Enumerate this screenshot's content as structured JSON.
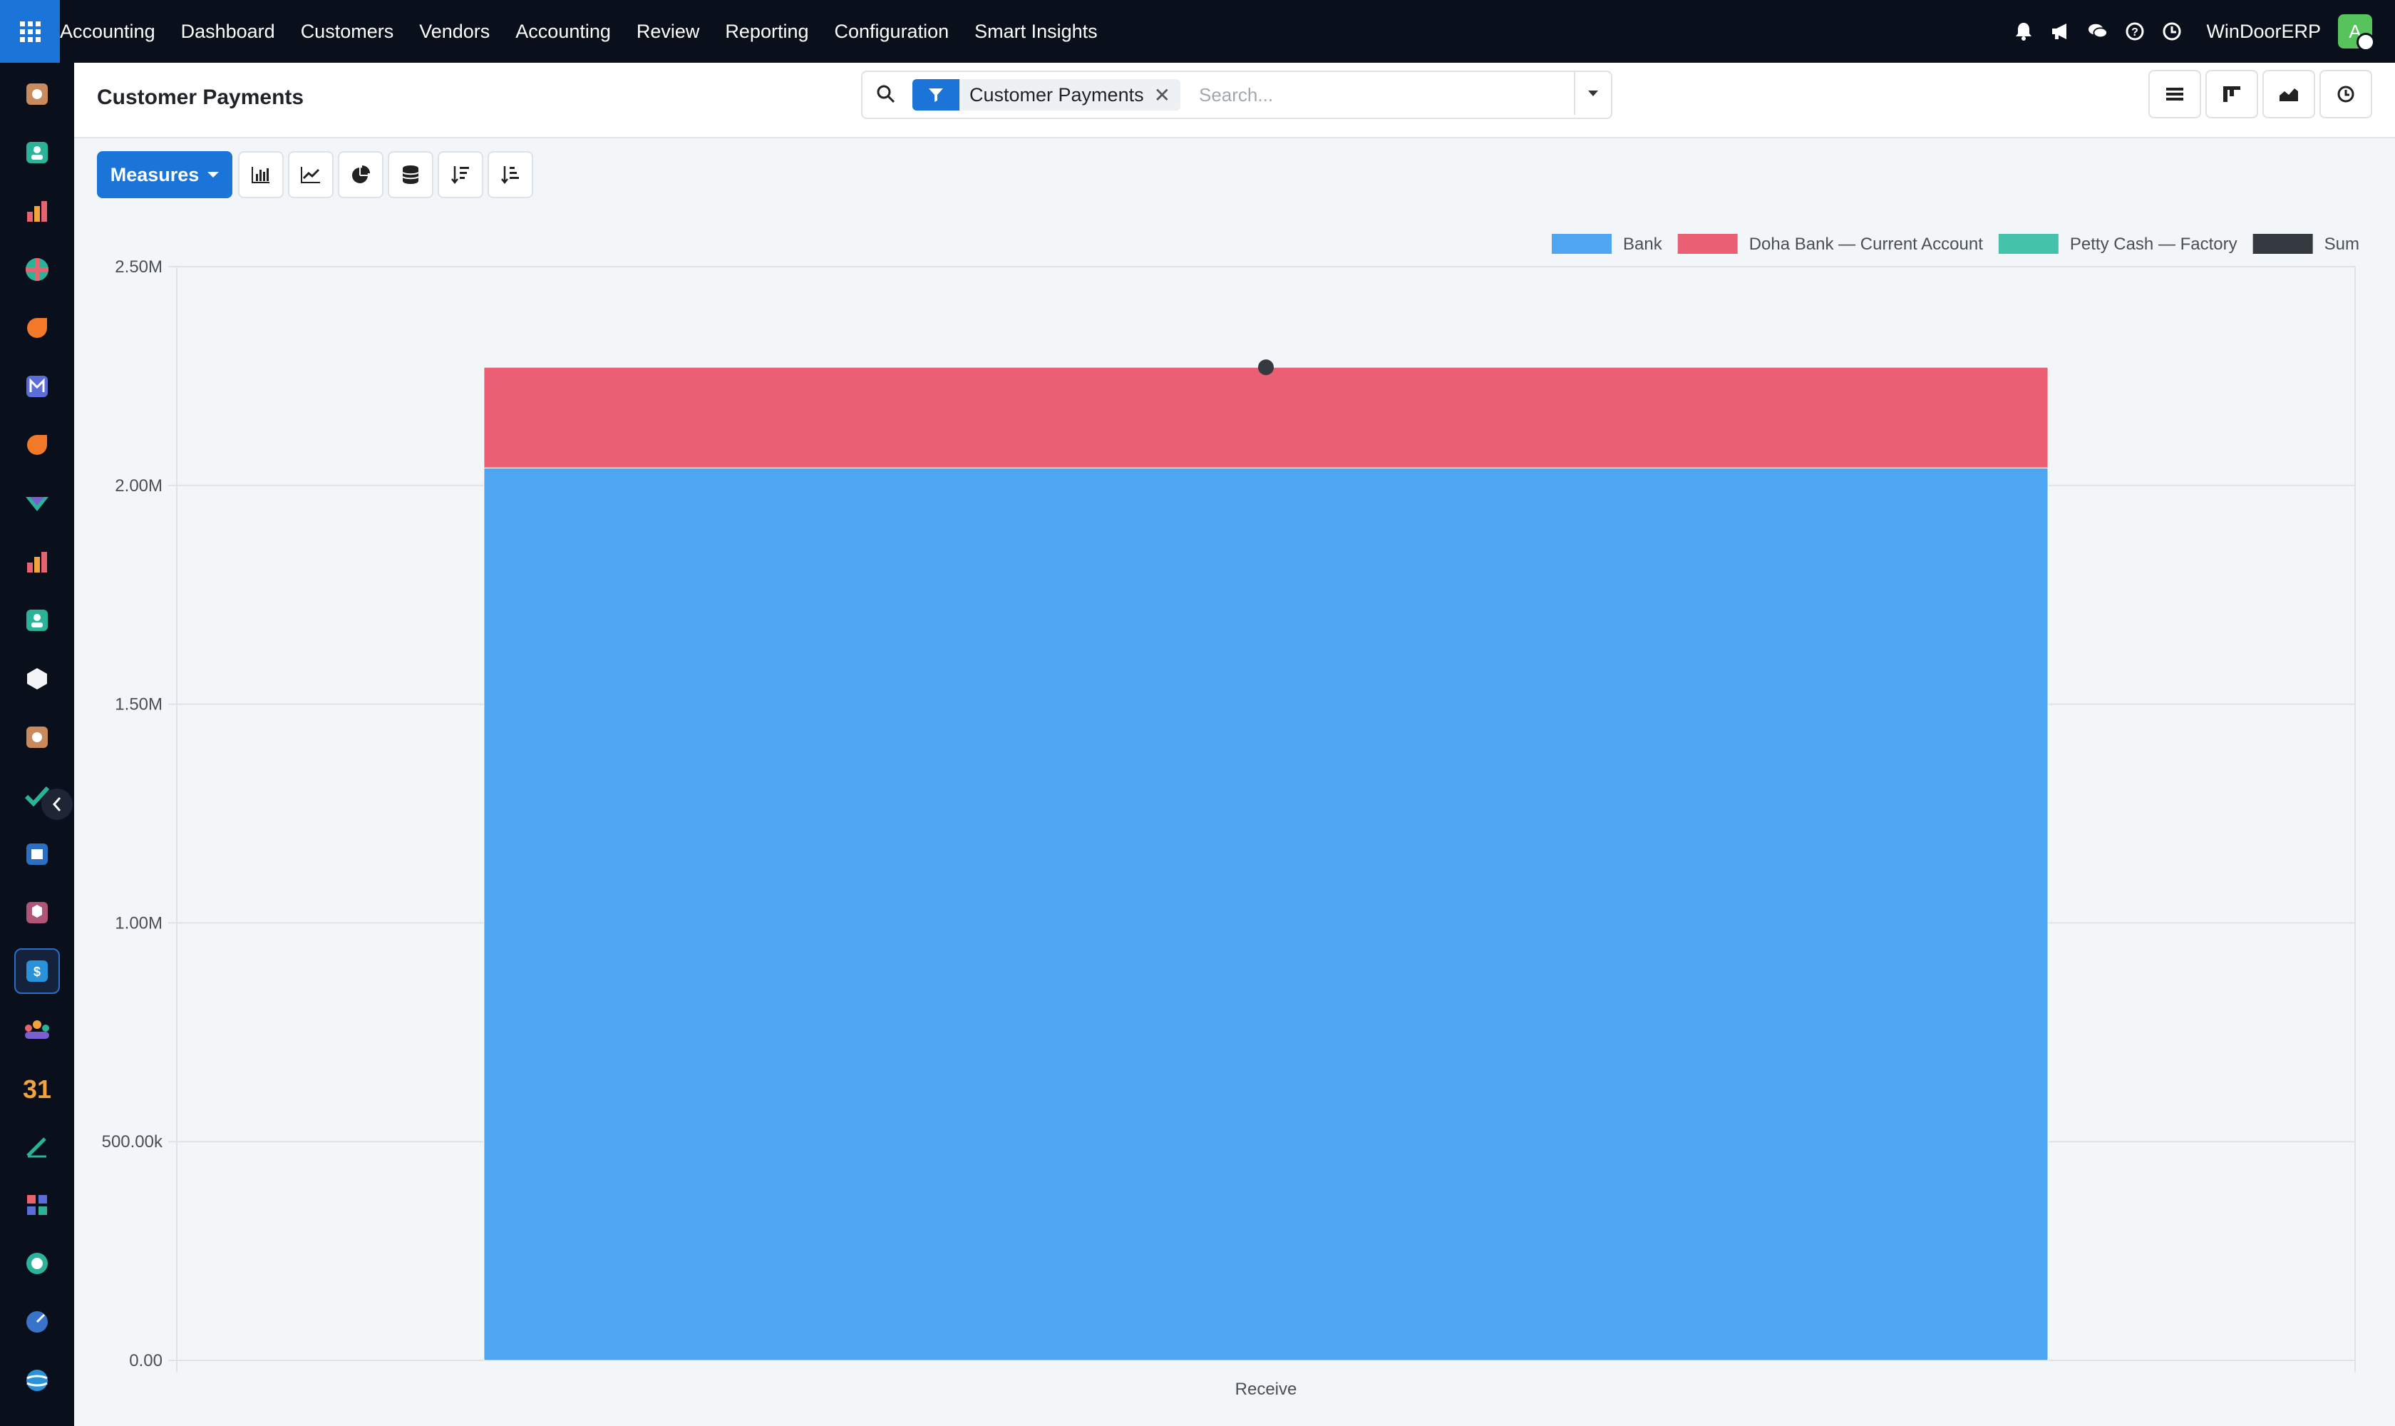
{
  "navbar": {
    "app_name": "Accounting",
    "menu": [
      "Dashboard",
      "Customers",
      "Vendors",
      "Accounting",
      "Review",
      "Reporting",
      "Configuration",
      "Smart Insights"
    ],
    "company": "WinDoorERP",
    "avatar_initial": "A",
    "systray_icons": [
      "bell-icon",
      "megaphone-icon",
      "chat-icon",
      "help-icon",
      "clock-icon"
    ]
  },
  "control_panel": {
    "title": "Customer Payments",
    "facet_label": "Customer Payments",
    "facet_remove": "✕",
    "search_placeholder": "Search..."
  },
  "toolbar": {
    "measures_label": "Measures",
    "chart_buttons": [
      "bar-chart-icon",
      "line-chart-icon",
      "pie-chart-icon",
      "stacked-icon",
      "sort-descending-icon",
      "sort-ascending-icon"
    ]
  },
  "view_switcher": [
    "list-view-icon",
    "kanban-view-icon",
    "graph-view-icon",
    "activity-view-icon"
  ],
  "colors": {
    "bank": "#4ea5f2",
    "doha": "#ea5f73",
    "petty": "#44c3aa",
    "sum": "#34383f",
    "accent": "#1b74d8"
  },
  "chart_data": {
    "type": "bar",
    "stacked": true,
    "categories": [
      "Receive"
    ],
    "series": [
      {
        "name": "Bank",
        "values": [
          2040000
        ],
        "color": "#4ea5f2"
      },
      {
        "name": "Doha Bank — Current Account",
        "values": [
          230000
        ],
        "color": "#ea5f73"
      },
      {
        "name": "Petty Cash — Factory",
        "values": [
          0
        ],
        "color": "#44c3aa"
      },
      {
        "name": "Sum",
        "values": [
          2270000
        ],
        "color": "#34383f",
        "kind": "point"
      }
    ],
    "yticks": [
      "0.00",
      "500.00k",
      "1.00M",
      "1.50M",
      "2.00M",
      "2.50M"
    ],
    "ytick_values": [
      0,
      500000,
      1000000,
      1500000,
      2000000,
      2500000
    ],
    "ylim": [
      0,
      2500000
    ],
    "grid": true,
    "legend_position": "top-right"
  }
}
